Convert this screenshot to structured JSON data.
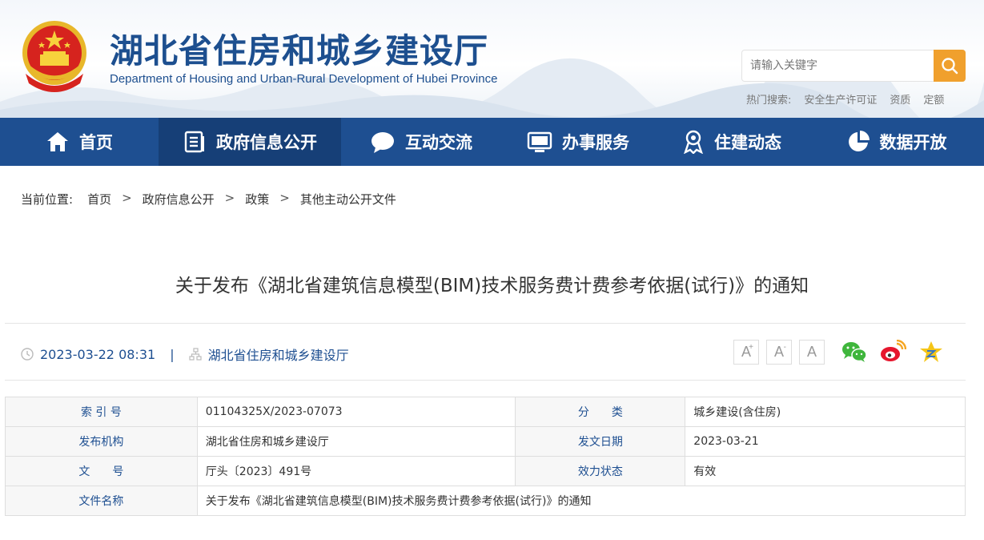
{
  "header": {
    "title": "湖北省住房和城乡建设厅",
    "subtitle": "Department of Housing and Urban-Rural Development of Hubei Province",
    "search_placeholder": "请输入关键字",
    "hot_label": "热门搜索:",
    "hot_items": [
      "安全生产许可证",
      "资质",
      "定额"
    ]
  },
  "nav": [
    {
      "label": "首页",
      "icon": "home-icon"
    },
    {
      "label": "政府信息公开",
      "icon": "document-list-icon"
    },
    {
      "label": "互动交流",
      "icon": "chat-bubble-icon"
    },
    {
      "label": "办事服务",
      "icon": "monitor-icon"
    },
    {
      "label": "住建动态",
      "icon": "person-badge-icon"
    },
    {
      "label": "数据开放",
      "icon": "pie-chart-icon"
    }
  ],
  "breadcrumb": {
    "label": "当前位置:",
    "items": [
      "首页",
      "政府信息公开",
      "政策",
      "其他主动公开文件"
    ],
    "sep": ">"
  },
  "article": {
    "title": "关于发布《湖北省建筑信息模型(BIM)技术服务费计费参考依据(试行)》的通知",
    "datetime": "2023-03-22 08:31",
    "separator": "|",
    "source": "湖北省住房和城乡建设厅"
  },
  "font_sizes": [
    "A",
    "A",
    "A"
  ],
  "font_size_marks": [
    "+",
    "-",
    ""
  ],
  "table": {
    "r1": {
      "k1": "索 引 号",
      "v1": "01104325X/2023-07073",
      "k2": "分　　类",
      "v2": "城乡建设(含住房)"
    },
    "r2": {
      "k1": "发布机构",
      "v1": "湖北省住房和城乡建设厅",
      "k2": "发文日期",
      "v2": "2023-03-21"
    },
    "r3": {
      "k1": "文　　号",
      "v1": "厅头〔2023〕491号",
      "k2": "效力状态",
      "v2": "有效"
    },
    "r4": {
      "k1": "文件名称",
      "v1": "关于发布《湖北省建筑信息模型(BIM)技术服务费计费参考依据(试行)》的通知"
    }
  },
  "colors": {
    "brand": "#1e4f91",
    "nav_active": "#163f77",
    "search_button": "#f0a02d"
  }
}
